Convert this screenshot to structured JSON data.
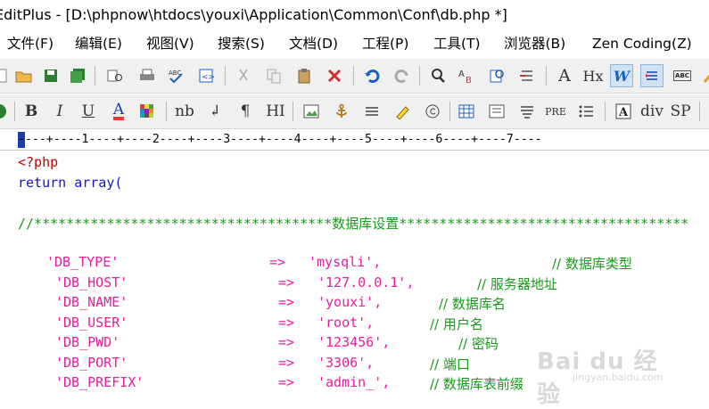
{
  "window": {
    "title": "EditPlus - [D:\\phpnow\\htdocs\\youxi\\Application\\Common\\Conf\\db.php *]"
  },
  "menu": [
    "文件(F)",
    "编辑(E)",
    "视图(V)",
    "搜索(S)",
    "文档(D)",
    "工程(P)",
    "工具(T)",
    "浏览器(B)",
    "Zen Coding(Z)"
  ],
  "toolbar2_text": {
    "bold": "B",
    "italic": "I",
    "underline": "U",
    "color": "A",
    "nb": "nb",
    "newline": "↲",
    "pilcrow": "¶",
    "heading": "HI",
    "pre": "PRE",
    "div": "div",
    "sp": "SP"
  },
  "toolbar1_text": {
    "hx": "Hx",
    "w": "W",
    "font": "A",
    "abc": "ABC"
  },
  "ruler": "----+----1----+----2----+----3----+----4----+----5----+----6----+----7----",
  "code": {
    "line1": "<?php",
    "line2": "return array(",
    "comment_prefix": "//*************************************",
    "comment_title": "数据库设置",
    "comment_suffix": "************************************",
    "rows": [
      {
        "key": "'DB_TYPE'",
        "arrow": "=>",
        "value": "'mysqli',",
        "comment": "// 数据库类型"
      },
      {
        "key": "'DB_HOST'",
        "arrow": "=>",
        "value": "'127.0.0.1',",
        "comment": "// 服务器地址"
      },
      {
        "key": "'DB_NAME'",
        "arrow": "=>",
        "value": "'youxi',",
        "comment": "// 数据库名"
      },
      {
        "key": "'DB_USER'",
        "arrow": "=>",
        "value": "'root',",
        "comment": "// 用户名"
      },
      {
        "key": "'DB_PWD'",
        "arrow": "=>",
        "value": "'123456',",
        "comment": "// 密码"
      },
      {
        "key": "'DB_PORT'",
        "arrow": "=>",
        "value": "'3306',",
        "comment": "// 端口"
      },
      {
        "key": "'DB_PREFIX'",
        "arrow": "=>",
        "value": "'admin_',",
        "comment": "// 数据库表前缀"
      }
    ]
  },
  "watermark": {
    "brand": "Bai du 经验",
    "url": "jingyan.baidu.com"
  },
  "colors": {
    "keyword": "#1414c8",
    "string": "#e61ea0",
    "comment": "#1a9a1a",
    "tag": "#c00000"
  }
}
